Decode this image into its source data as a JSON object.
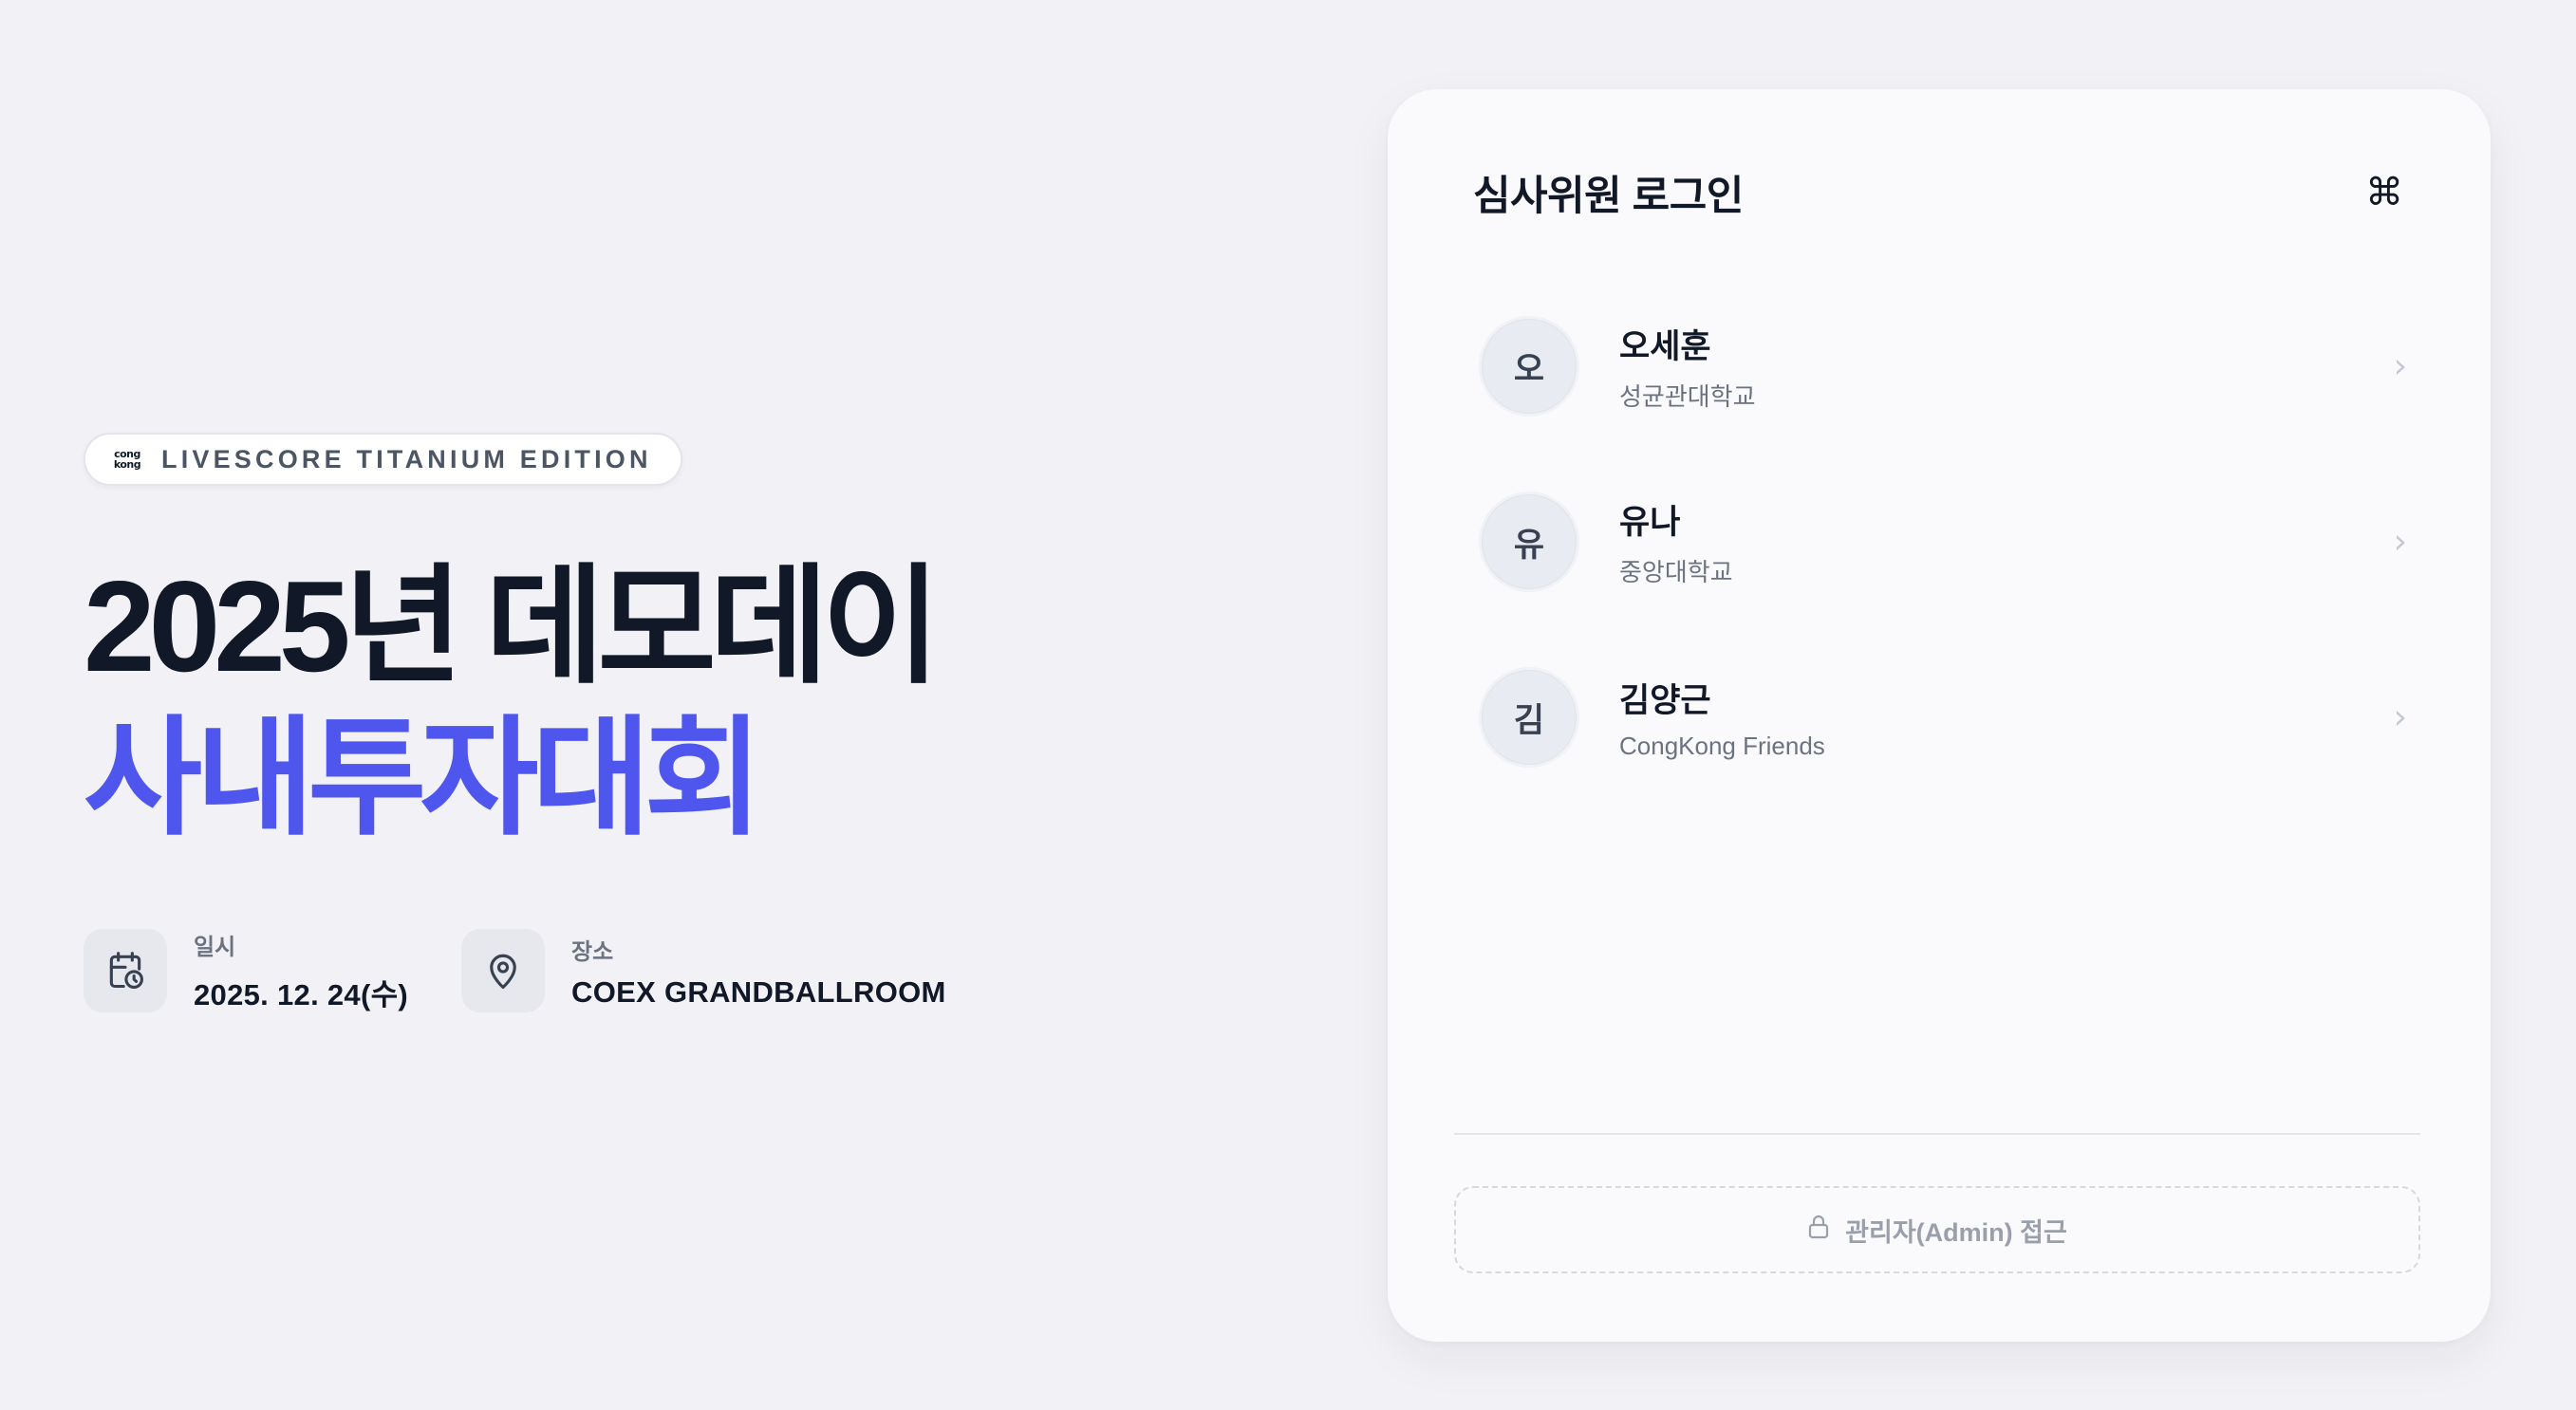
{
  "hero": {
    "badge": {
      "logo_line1": "cong",
      "logo_line2": "kong",
      "text": "LIVESCORE TITANIUM EDITION"
    },
    "title_line1": "2025년 데모데이",
    "title_line2": "사내투자대회",
    "title_line2_color": "#4f56ee",
    "meta": {
      "date_label": "일시",
      "date_value": "2025. 12. 24(수)",
      "date_icon": "calendar-clock-icon",
      "place_label": "장소",
      "place_value": "COEX GRANDBALLROOM",
      "place_icon": "map-pin-icon"
    }
  },
  "login_card": {
    "title": "심사위원 로그인",
    "shortcut_icon": "⌘",
    "judges": [
      {
        "initial": "오",
        "name": "오세훈",
        "affiliation": "성균관대학교"
      },
      {
        "initial": "유",
        "name": "유나",
        "affiliation": "중앙대학교"
      },
      {
        "initial": "김",
        "name": "김양근",
        "affiliation": "CongKong Friends"
      }
    ],
    "chevron": "›",
    "admin_button_label": "관리자(Admin) 접근",
    "admin_icon": "lock-icon"
  }
}
